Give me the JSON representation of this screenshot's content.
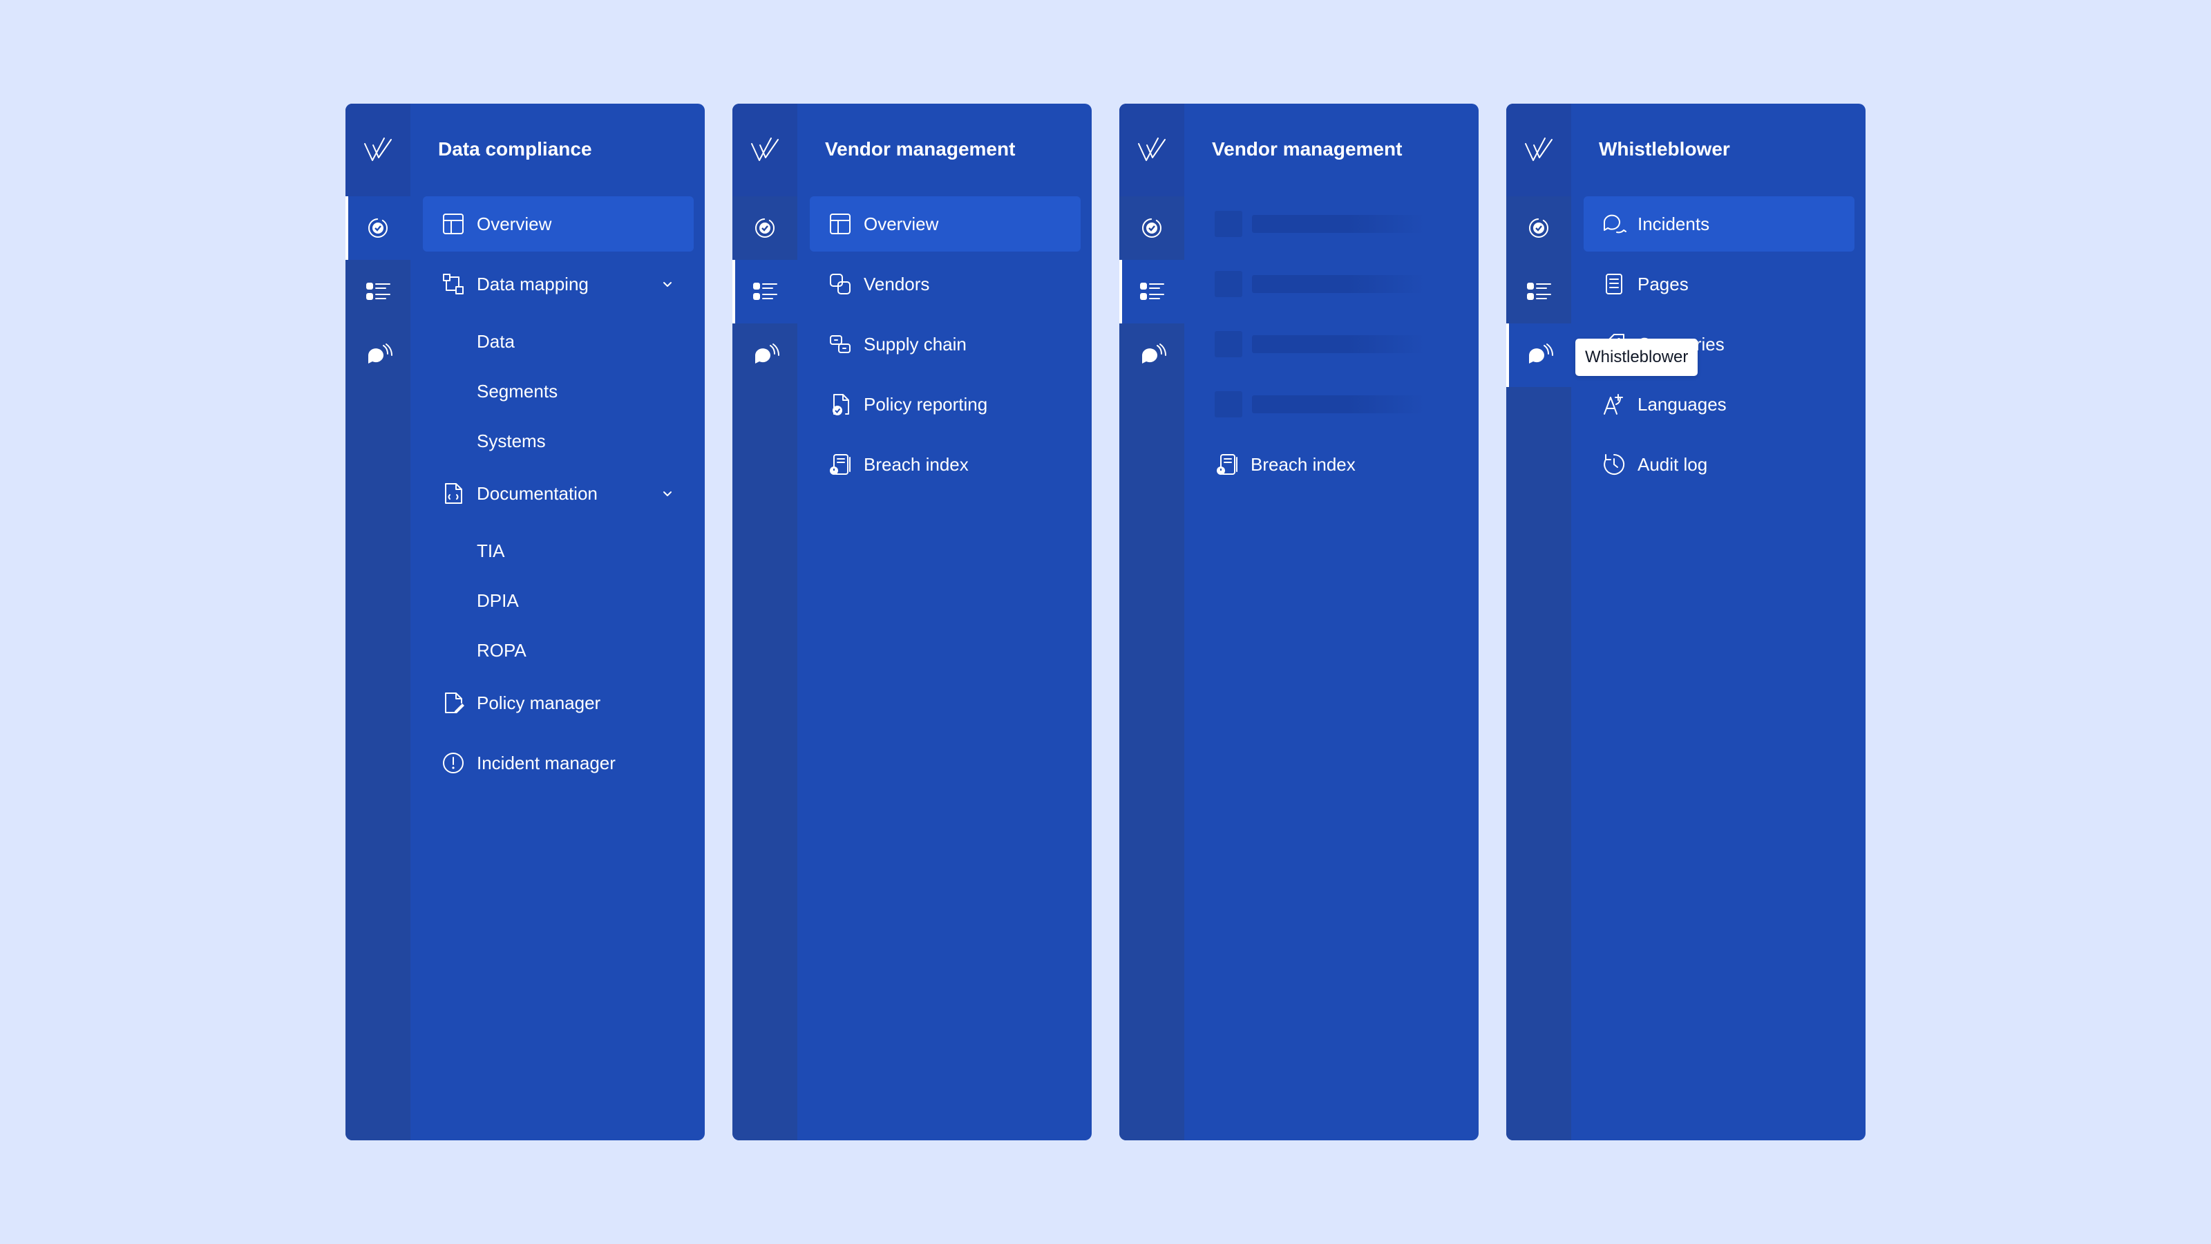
{
  "panels": [
    {
      "title": "Data compliance",
      "items": [
        {
          "label": "Overview",
          "icon": "layout-icon",
          "active": true
        },
        {
          "label": "Data mapping",
          "icon": "mapping-icon",
          "expanded": true,
          "children": [
            "Data",
            "Segments",
            "Systems"
          ]
        },
        {
          "label": "Documentation",
          "icon": "documentation-icon",
          "expanded": true,
          "children": [
            "TIA",
            "DPIA",
            "ROPA"
          ]
        },
        {
          "label": "Policy manager",
          "icon": "policy-edit-icon"
        },
        {
          "label": "Incident manager",
          "icon": "alert-circle-icon"
        }
      ]
    },
    {
      "title": "Vendor management",
      "items": [
        {
          "label": "Overview",
          "icon": "layout-icon",
          "active": true
        },
        {
          "label": "Vendors",
          "icon": "vendors-icon"
        },
        {
          "label": "Supply chain",
          "icon": "supply-chain-icon"
        },
        {
          "label": "Policy reporting",
          "icon": "policy-report-icon"
        },
        {
          "label": "Breach index",
          "icon": "breach-index-icon"
        }
      ]
    },
    {
      "title": "Vendor management",
      "loading_rows": 4,
      "items": [
        {
          "label": "Breach index",
          "icon": "breach-index-icon"
        }
      ]
    },
    {
      "title": "Whistleblower",
      "items": [
        {
          "label": "Incidents",
          "icon": "chat-bubbles-icon",
          "active": true
        },
        {
          "label": "Pages",
          "icon": "page-icon"
        },
        {
          "label": "Categories",
          "icon": "tag-icon"
        },
        {
          "label": "Languages",
          "icon": "language-icon"
        },
        {
          "label": "Audit log",
          "icon": "history-clock-icon"
        }
      ]
    }
  ],
  "rail": {
    "buttons": [
      "compliance-icon",
      "vendor-list-icon",
      "whistleblower-icon"
    ],
    "active_by_panel": [
      0,
      1,
      1,
      2
    ]
  },
  "tooltip": {
    "text": "Whistleblower"
  },
  "colors": {
    "background": "#dce6fe",
    "panel": "#1e4bb4",
    "rail": "#22479f",
    "active_item": "#2458cc",
    "text": "#ffffff"
  }
}
